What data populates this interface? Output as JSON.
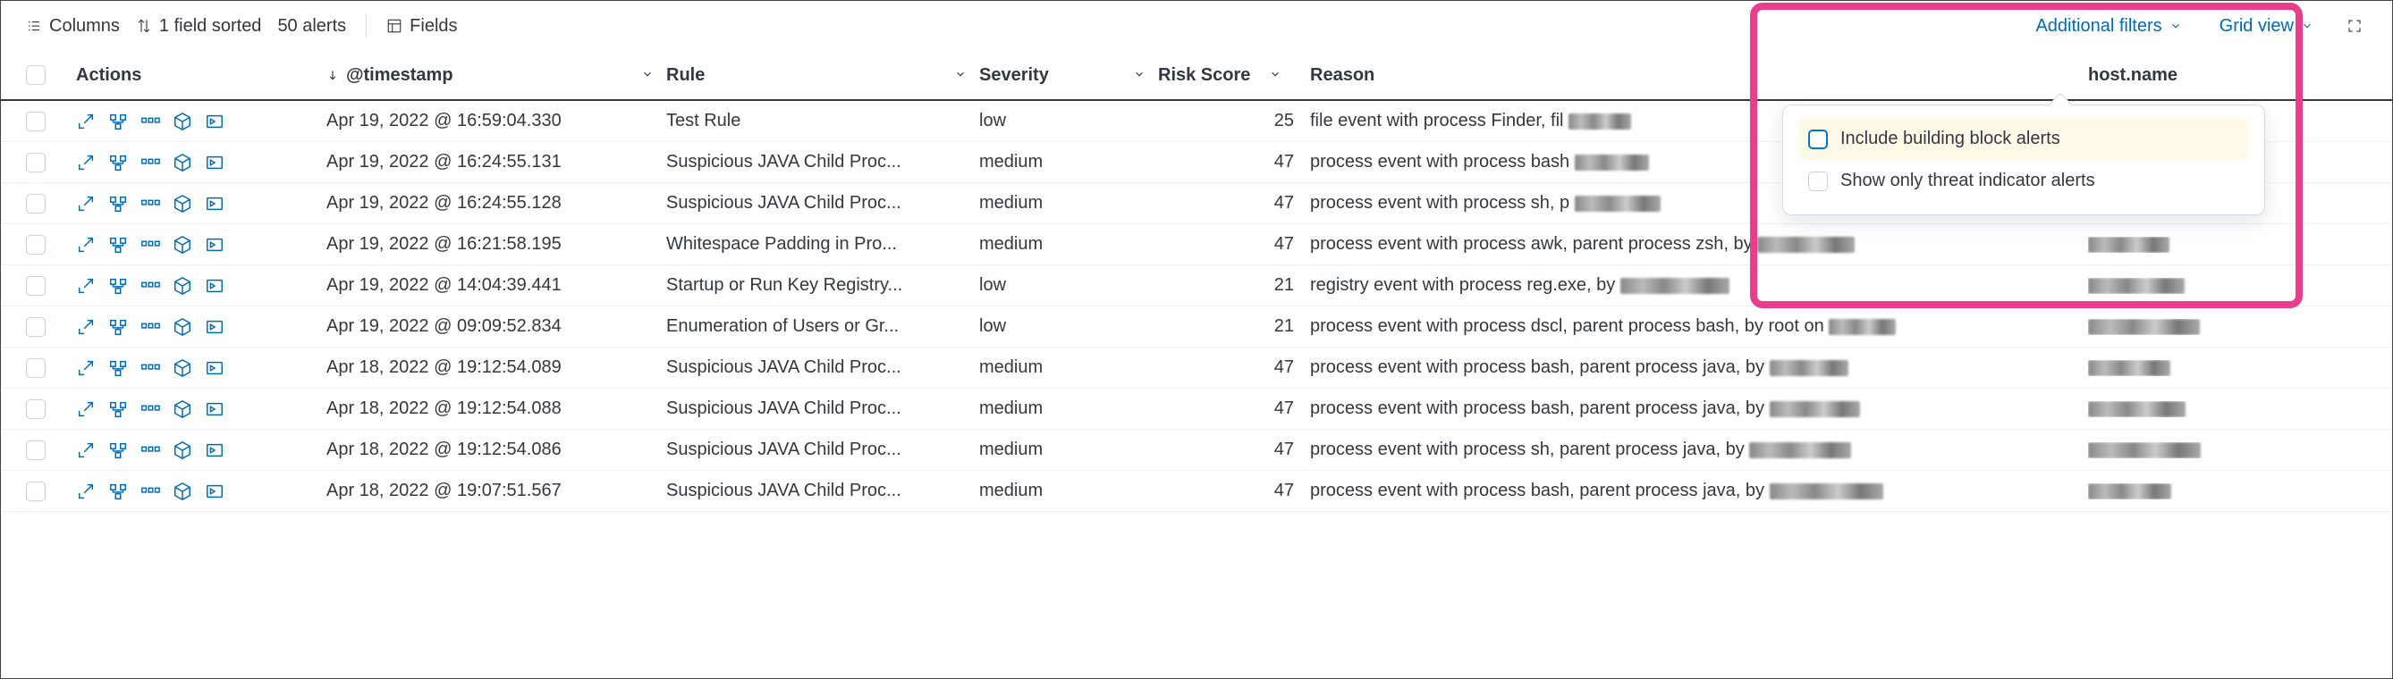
{
  "toolbar": {
    "columns_label": "Columns",
    "sorted_label": "1 field sorted",
    "alerts_count_label": "50 alerts",
    "fields_label": "Fields",
    "additional_filters_label": "Additional filters",
    "grid_view_label": "Grid view"
  },
  "popover": {
    "opt_building_block": "Include building block alerts",
    "opt_threat_indicator": "Show only threat indicator alerts"
  },
  "columns": {
    "actions": "Actions",
    "timestamp": "@timestamp",
    "rule": "Rule",
    "severity": "Severity",
    "risk": "Risk Score",
    "reason": "Reason",
    "host": "host.name"
  },
  "rows": [
    {
      "ts": "Apr 19, 2022 @ 16:59:04.330",
      "rule": "Test Rule",
      "sev": "low",
      "risk": 25,
      "reason": "file event with process Finder, fil"
    },
    {
      "ts": "Apr 19, 2022 @ 16:24:55.131",
      "rule": "Suspicious JAVA Child Proc...",
      "sev": "medium",
      "risk": 47,
      "reason": "process event with process bash"
    },
    {
      "ts": "Apr 19, 2022 @ 16:24:55.128",
      "rule": "Suspicious JAVA Child Proc...",
      "sev": "medium",
      "risk": 47,
      "reason": "process event with process sh, p"
    },
    {
      "ts": "Apr 19, 2022 @ 16:21:58.195",
      "rule": "Whitespace Padding in Pro...",
      "sev": "medium",
      "risk": 47,
      "reason": "process event with process awk, parent process zsh, by "
    },
    {
      "ts": "Apr 19, 2022 @ 14:04:39.441",
      "rule": "Startup or Run Key Registry...",
      "sev": "low",
      "risk": 21,
      "reason": "registry event with process reg.exe, by "
    },
    {
      "ts": "Apr 19, 2022 @ 09:09:52.834",
      "rule": "Enumeration of Users or Gr...",
      "sev": "low",
      "risk": 21,
      "reason": "process event with process dscl, parent process bash, by root on "
    },
    {
      "ts": "Apr 18, 2022 @ 19:12:54.089",
      "rule": "Suspicious JAVA Child Proc...",
      "sev": "medium",
      "risk": 47,
      "reason": "process event with process bash, parent process java, by "
    },
    {
      "ts": "Apr 18, 2022 @ 19:12:54.088",
      "rule": "Suspicious JAVA Child Proc...",
      "sev": "medium",
      "risk": 47,
      "reason": "process event with process bash, parent process java, by "
    },
    {
      "ts": "Apr 18, 2022 @ 19:12:54.086",
      "rule": "Suspicious JAVA Child Proc...",
      "sev": "medium",
      "risk": 47,
      "reason": "process event with process sh, parent process java, by "
    },
    {
      "ts": "Apr 18, 2022 @ 19:07:51.567",
      "rule": "Suspicious JAVA Child Proc...",
      "sev": "medium",
      "risk": 47,
      "reason": "process event with process bash, parent process java, by "
    }
  ]
}
